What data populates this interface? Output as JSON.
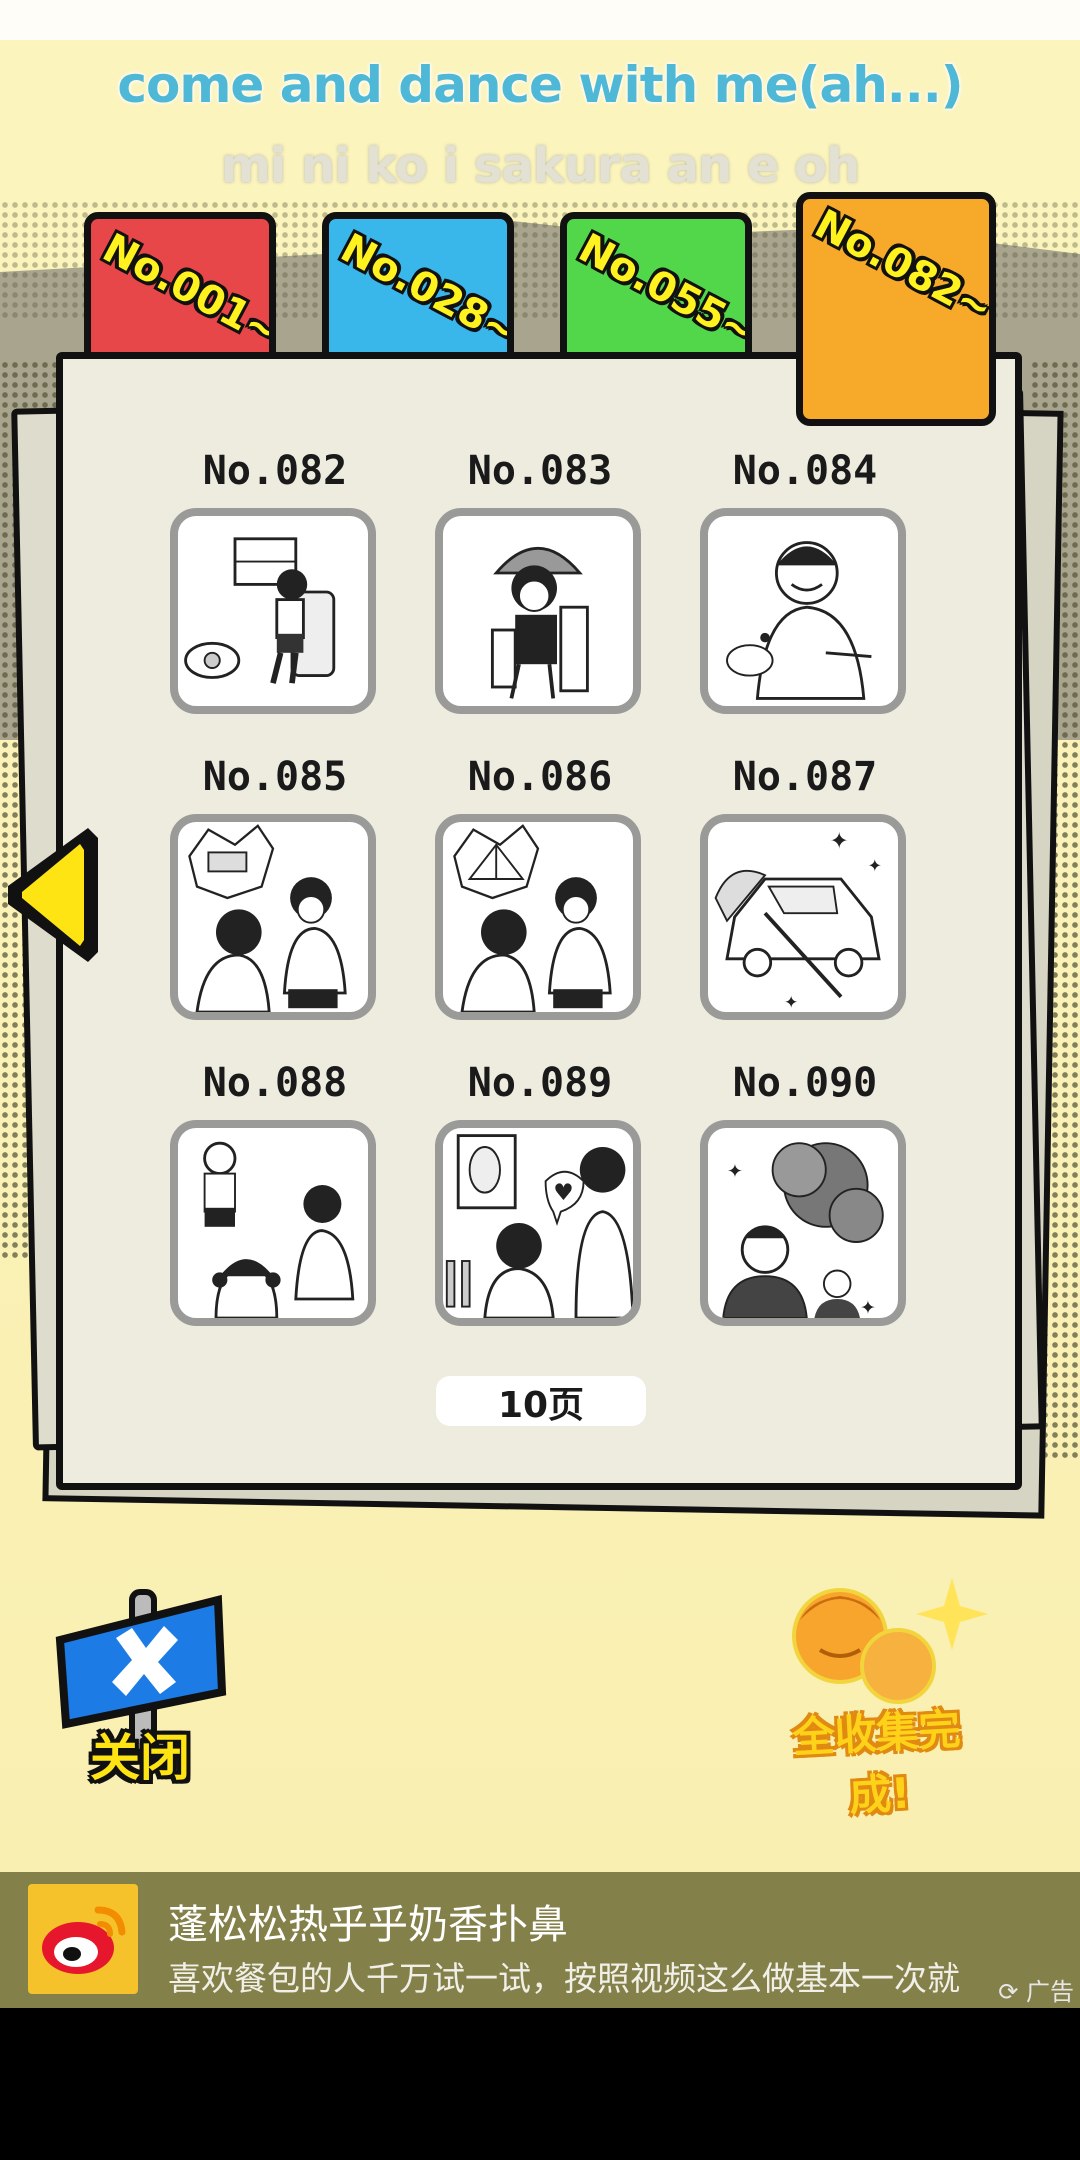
{
  "lyrics": {
    "line1": "come and dance with me(ah...)",
    "line2": "mi ni ko i sakura an e oh"
  },
  "tabs": [
    {
      "label": "No.001~",
      "color": "#e8474a",
      "active": false
    },
    {
      "label": "No.028~",
      "color": "#39b6ea",
      "active": false
    },
    {
      "label": "No.055~",
      "color": "#52d64a",
      "active": false
    },
    {
      "label": "No.082~",
      "color": "#f7a929",
      "active": true
    }
  ],
  "cards": [
    {
      "label": "No.082",
      "icon": "train-passenger-icon"
    },
    {
      "label": "No.083",
      "icon": "hair-dryer-woman-icon"
    },
    {
      "label": "No.084",
      "icon": "boy-with-bug-icon"
    },
    {
      "label": "No.085",
      "icon": "shocked-couple-bed-icon"
    },
    {
      "label": "No.086",
      "icon": "shocked-couple-tent-icon"
    },
    {
      "label": "No.087",
      "icon": "duster-car-icon"
    },
    {
      "label": "No.088",
      "icon": "family-chaos-icon"
    },
    {
      "label": "No.089",
      "icon": "doctor-poster-icon"
    },
    {
      "label": "No.090",
      "icon": "explosion-businessmen-icon"
    }
  ],
  "pagination": {
    "label": "10页"
  },
  "controls": {
    "close_label": "关闭",
    "complete_label": "全收集完成!"
  },
  "ad": {
    "title": "蓬松松热乎乎奶香扑鼻",
    "description": "喜欢餐包的人千万试一试，按照视频这么做基本一次就",
    "tag": "广告"
  }
}
